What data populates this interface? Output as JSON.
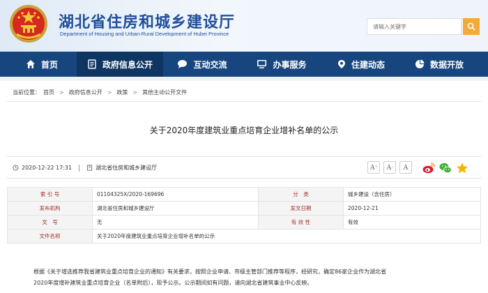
{
  "header": {
    "title": "湖北省住房和城乡建设厅",
    "subtitle": "Department of Housing and Urban-Rural Development of Hubei Province",
    "search_placeholder": "请输入关键字"
  },
  "nav": {
    "items": [
      {
        "label": "首页",
        "icon": "home-icon"
      },
      {
        "label": "政府信息公开",
        "icon": "document-icon"
      },
      {
        "label": "互动交流",
        "icon": "chat-icon"
      },
      {
        "label": "办事服务",
        "icon": "monitor-icon"
      },
      {
        "label": "住建动态",
        "icon": "pin-icon"
      },
      {
        "label": "数据开放",
        "icon": "pie-icon"
      }
    ]
  },
  "breadcrumb": {
    "prefix": "当前位置：",
    "items": [
      "首页",
      "政府信息公开",
      "政策",
      "其他主动公开文件"
    ]
  },
  "article": {
    "title": "关于2020年度建筑业重点培育企业增补名单的公示",
    "datetime": "2020-12-22 17:31",
    "source": "湖北省住房和城乡建设厅",
    "font_buttons": [
      "A",
      "A",
      "A"
    ]
  },
  "info": {
    "rows": [
      {
        "l1": "索 引 号",
        "v1": "01104325X/2020-169696",
        "l2": "分　类",
        "v2": "城乡建设（含住房）"
      },
      {
        "l1": "发布机构",
        "v1": "湖北省住房和城乡建设厅",
        "l2": "发文日期",
        "v2": "2020-12-21"
      },
      {
        "l1": "文　号",
        "v1": "无",
        "l2": "有 效 性",
        "v2": "有效"
      }
    ],
    "name_label": "文件名称",
    "name_value": "关于2020年度建筑业重点培育企业增补名单的公示"
  },
  "body": {
    "line1": "根据《关于增选推荐我省建筑业重点培育企业的通知》有关要求，按照企业申请、市级主管部门推荐等程序，经研究，确定86家企业作为湖北省",
    "line2": "2020年度增补建筑业重点培育企业（名单附后），现予公示。公示期间如有问题，请向湖北省建筑事业中心反映。"
  },
  "colors": {
    "nav_bg": "#17467f",
    "nav_active": "#0f3562",
    "title_blue": "#1f4f9a",
    "search_btn": "#f4a93b",
    "label_red": "#a0332a"
  }
}
